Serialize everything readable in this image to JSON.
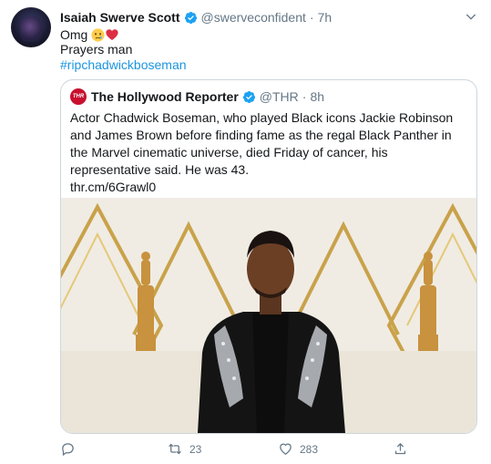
{
  "tweet": {
    "author_name": "Isaiah Swerve Scott",
    "author_handle": "@swerveconfident",
    "separator": "·",
    "time": "7h",
    "line1": "Omg",
    "line2": "Prayers man",
    "hashtag": "#ripchadwickboseman"
  },
  "quoted": {
    "avatar_text": "THR",
    "author_name": "The Hollywood Reporter",
    "author_handle": "@THR",
    "separator": "·",
    "time": "8h",
    "body": "Actor Chadwick Boseman, who played Black icons Jackie Robinson and James Brown before finding fame as the regal Black Panther in the Marvel cinematic universe, died Friday of cancer, his representative said. He was 43.",
    "link": "thr.cm/6Grawl0"
  },
  "actions": {
    "reply_icon": "reply-icon",
    "retweet_count": "23",
    "like_count": "283",
    "share_icon": "share-icon"
  },
  "colors": {
    "link": "#1b95e0",
    "muted": "#657786",
    "verified": "#1da1f2",
    "thr_brand": "#c8102e"
  }
}
